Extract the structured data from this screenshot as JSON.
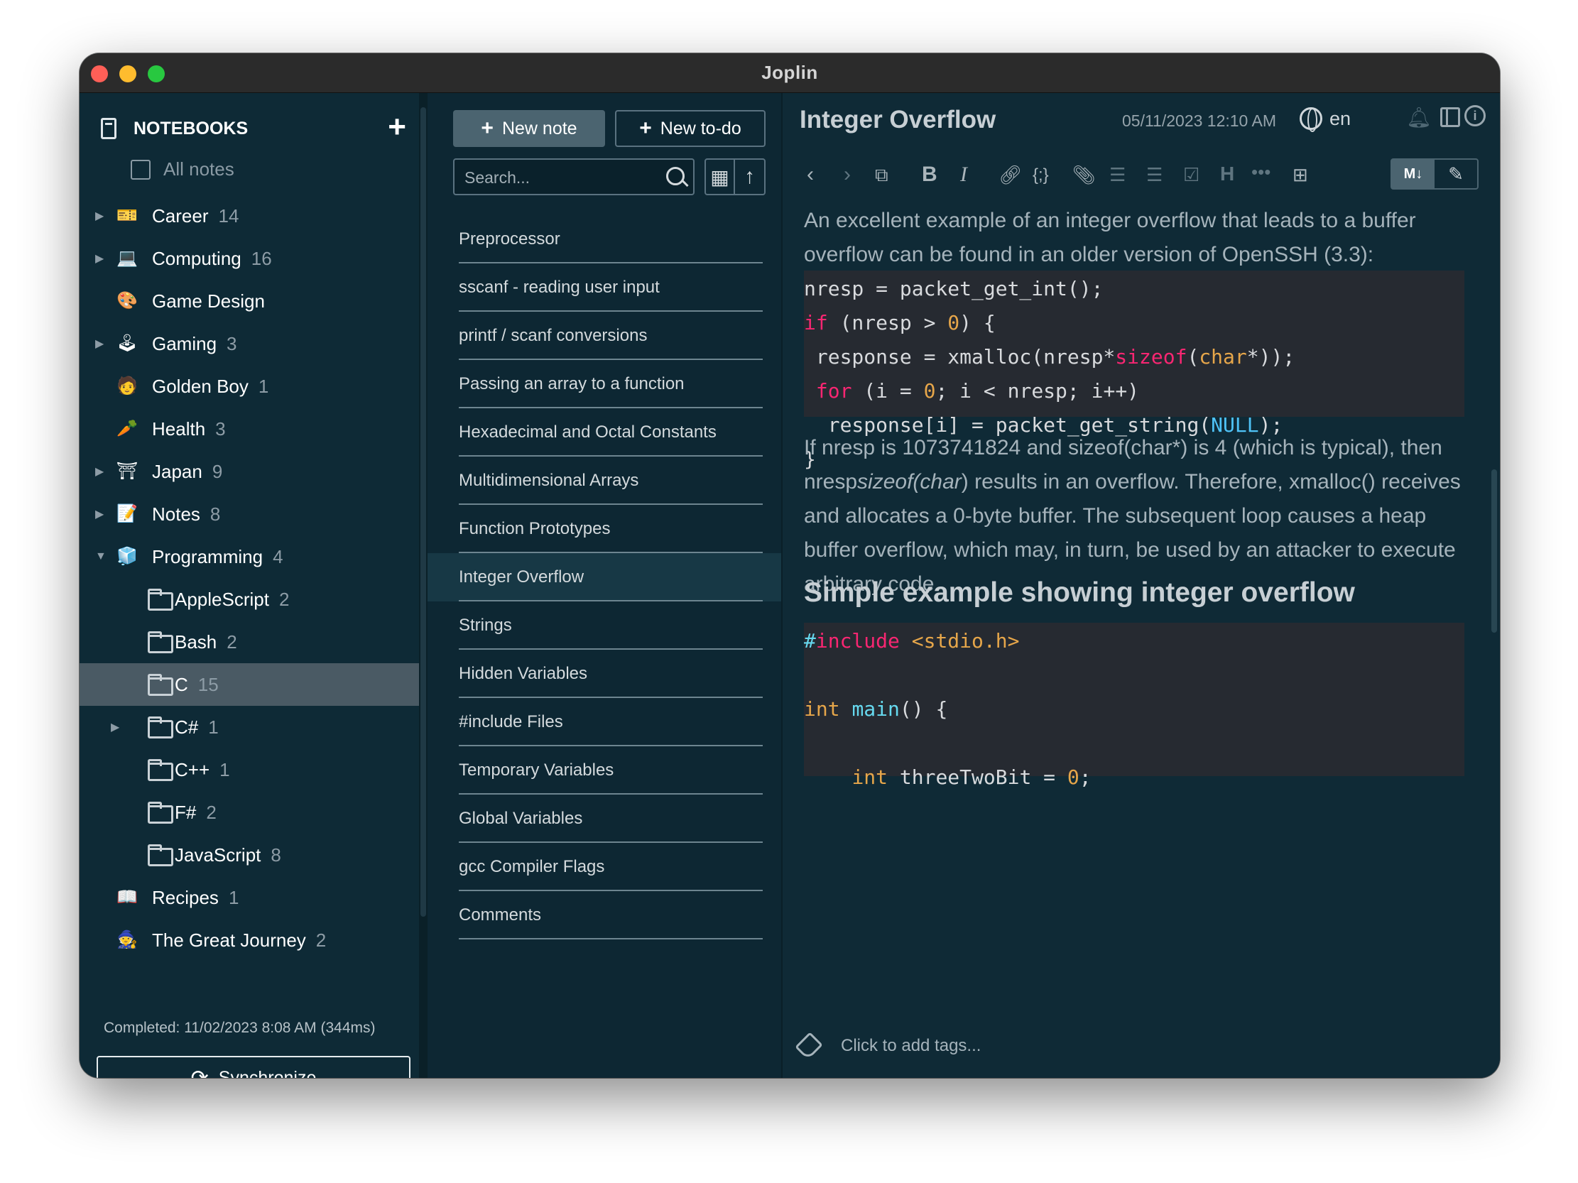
{
  "window": {
    "title": "Joplin"
  },
  "sidebar": {
    "header_label": "NOTEBOOKS",
    "add_icon": "plus-icon",
    "all_notes_label": "All notes",
    "notebooks": [
      {
        "name": "Career",
        "count": "14",
        "expandable": true,
        "depth": 0,
        "icon": "🎫"
      },
      {
        "name": "Computing",
        "count": "16",
        "expandable": true,
        "depth": 0,
        "icon": "💻"
      },
      {
        "name": "Game Design",
        "count": "",
        "expandable": false,
        "depth": 0,
        "icon": "🎨"
      },
      {
        "name": "Gaming",
        "count": "3",
        "expandable": true,
        "depth": 0,
        "icon": "🕹"
      },
      {
        "name": "Golden Boy",
        "count": "1",
        "expandable": false,
        "depth": 0,
        "icon": "🧑"
      },
      {
        "name": "Health",
        "count": "3",
        "expandable": false,
        "depth": 0,
        "icon": "🥕"
      },
      {
        "name": "Japan",
        "count": "9",
        "expandable": true,
        "depth": 0,
        "icon": "⛩"
      },
      {
        "name": "Notes",
        "count": "8",
        "expandable": true,
        "depth": 0,
        "icon": "📝"
      },
      {
        "name": "Programming",
        "count": "4",
        "expandable": true,
        "expanded": true,
        "depth": 0,
        "icon": "🧊"
      },
      {
        "name": "AppleScript",
        "count": "2",
        "expandable": false,
        "depth": 1,
        "icon": "folder"
      },
      {
        "name": "Bash",
        "count": "2",
        "expandable": false,
        "depth": 1,
        "icon": "folder"
      },
      {
        "name": "C",
        "count": "15",
        "expandable": false,
        "depth": 1,
        "icon": "folder",
        "selected": true
      },
      {
        "name": "C#",
        "count": "1",
        "expandable": true,
        "depth": 1,
        "icon": "folder"
      },
      {
        "name": "C++",
        "count": "1",
        "expandable": false,
        "depth": 1,
        "icon": "folder"
      },
      {
        "name": "F#",
        "count": "2",
        "expandable": false,
        "depth": 1,
        "icon": "folder"
      },
      {
        "name": "JavaScript",
        "count": "8",
        "expandable": false,
        "depth": 1,
        "icon": "folder"
      },
      {
        "name": "Recipes",
        "count": "1",
        "expandable": false,
        "depth": 0,
        "icon": "📖"
      },
      {
        "name": "The Great Journey",
        "count": "2",
        "expandable": false,
        "depth": 0,
        "icon": "🧙"
      }
    ],
    "status_text": "Completed: 11/02/2023 8:08 AM (344ms)",
    "sync_label": "Synchronize"
  },
  "notelist": {
    "new_note_label": "New note",
    "new_todo_label": "New to-do",
    "search_placeholder": "Search...",
    "notes": [
      "Preprocessor",
      "sscanf - reading user input",
      "printf / scanf conversions",
      "Passing an array to a function",
      "Hexadecimal and Octal Constants",
      "Multidimensional Arrays",
      "Function Prototypes",
      "Integer Overflow",
      "Strings",
      "Hidden Variables",
      "#include Files",
      "Temporary Variables",
      "Global Variables",
      "gcc Compiler Flags",
      "Comments"
    ],
    "active_index": 7
  },
  "editor": {
    "title": "Integer Overflow",
    "date": "05/11/2023 12:10 AM",
    "language": "en",
    "intro": "An excellent example of an integer overflow that leads to a buffer overflow can be found in an older version of OpenSSH (3.3):",
    "para2_a": "If nresp is 1073741824 and sizeof(char*) is 4 (which is typical), then nresp",
    "para2_em": "sizeof(char",
    "para2_b": ") results in an overflow. Therefore, xmalloc() receives and allocates a 0-byte buffer. The subsequent loop causes a heap buffer overflow, which may, in turn, be used by an attacker to execute arbitrary code.",
    "heading": "Simple example showing integer overflow",
    "tags_placeholder": "Click to add tags...",
    "md_label": "M↓"
  }
}
